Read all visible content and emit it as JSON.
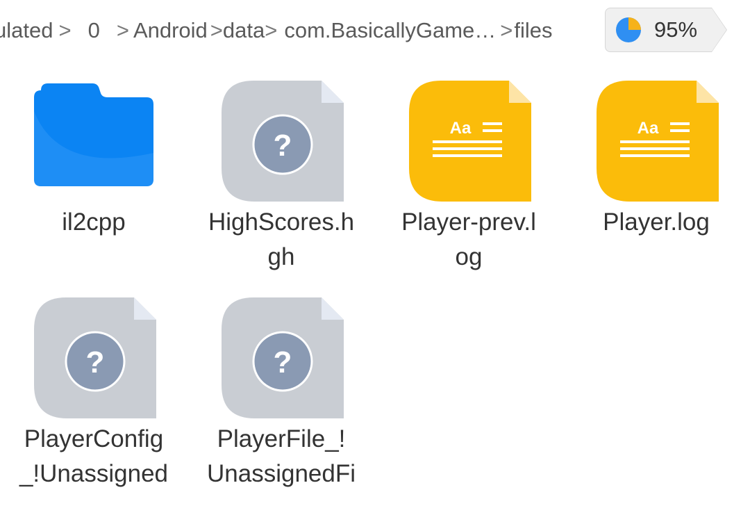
{
  "breadcrumb": {
    "items": [
      "ulated",
      "0",
      "Android",
      "data",
      "com.BasicallyGame…",
      "files"
    ],
    "separator": ">"
  },
  "storage": {
    "percent": "95%",
    "fraction_used": 0.95,
    "colors": {
      "used": "#2f8ff2",
      "free": "#f6b21a"
    }
  },
  "files": [
    {
      "name_lines": [
        "il2cpp"
      ],
      "type": "folder",
      "icon": "folder-icon"
    },
    {
      "name_lines": [
        "HighScores.h",
        "gh"
      ],
      "type": "unknown",
      "icon": "unknown-file-icon",
      "glyph": "?"
    },
    {
      "name_lines": [
        "Player-prev.l",
        "og"
      ],
      "type": "text",
      "icon": "text-file-icon",
      "glyph": "Aa"
    },
    {
      "name_lines": [
        "Player.log"
      ],
      "type": "text",
      "icon": "text-file-icon",
      "glyph": "Aa"
    },
    {
      "name_lines": [
        "PlayerConfig",
        "_!Unassigned"
      ],
      "type": "unknown",
      "icon": "unknown-file-icon",
      "glyph": "?"
    },
    {
      "name_lines": [
        "PlayerFile_!",
        "UnassignedFi"
      ],
      "type": "unknown",
      "icon": "unknown-file-icon",
      "glyph": "?"
    }
  ],
  "colors": {
    "folder": "#0b84f3",
    "text_file": "#fbbc0a",
    "unknown_file": "#c9cdd3",
    "unknown_badge": "#8a9ab3"
  }
}
